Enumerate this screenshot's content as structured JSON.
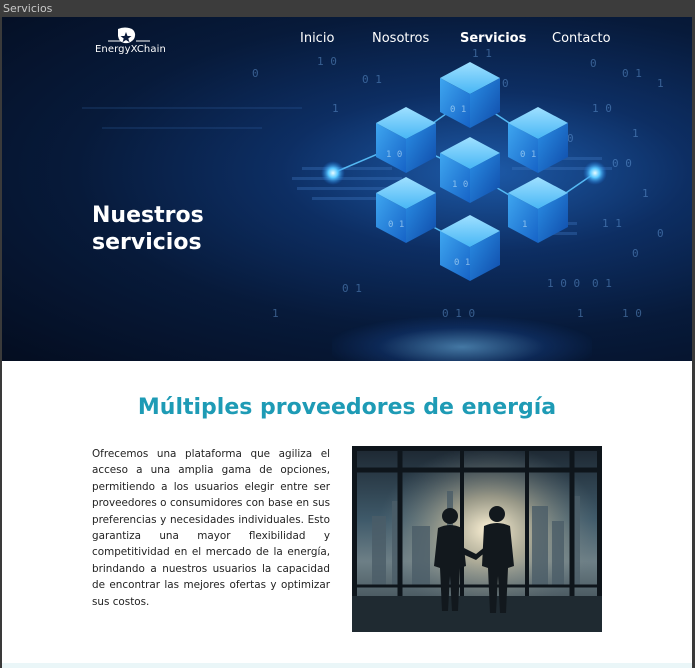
{
  "window": {
    "title": "Servicios"
  },
  "brand": {
    "name": "EnergyXChain"
  },
  "nav": {
    "items": [
      {
        "label": "Inicio",
        "active": false
      },
      {
        "label": "Nosotros",
        "active": false
      },
      {
        "label": "Servicios",
        "active": true
      },
      {
        "label": "Contacto",
        "active": false
      }
    ]
  },
  "hero": {
    "title_line1": "Nuestros",
    "title_line2": "servicios"
  },
  "section": {
    "title": "Múltiples proveedores de energía",
    "paragraph": "Ofrecemos una plataforma que agiliza el acceso a una amplia gama de opciones, permitiendo a los usuarios elegir entre ser proveedores o consumidores con base en sus preferencias y necesidades individuales. Esto garantiza una mayor flexibilidad y competitividad en el mercado de la energía, brindando a nuestros usuarios la capacidad de encontrar las mejores ofertas y optimizar sus costos."
  },
  "colors": {
    "accent": "#1e9bb5",
    "hero_dark": "#071a3a",
    "cube": "#3fa9f5"
  },
  "icons": {
    "logo": "star-sun-logo-icon"
  }
}
